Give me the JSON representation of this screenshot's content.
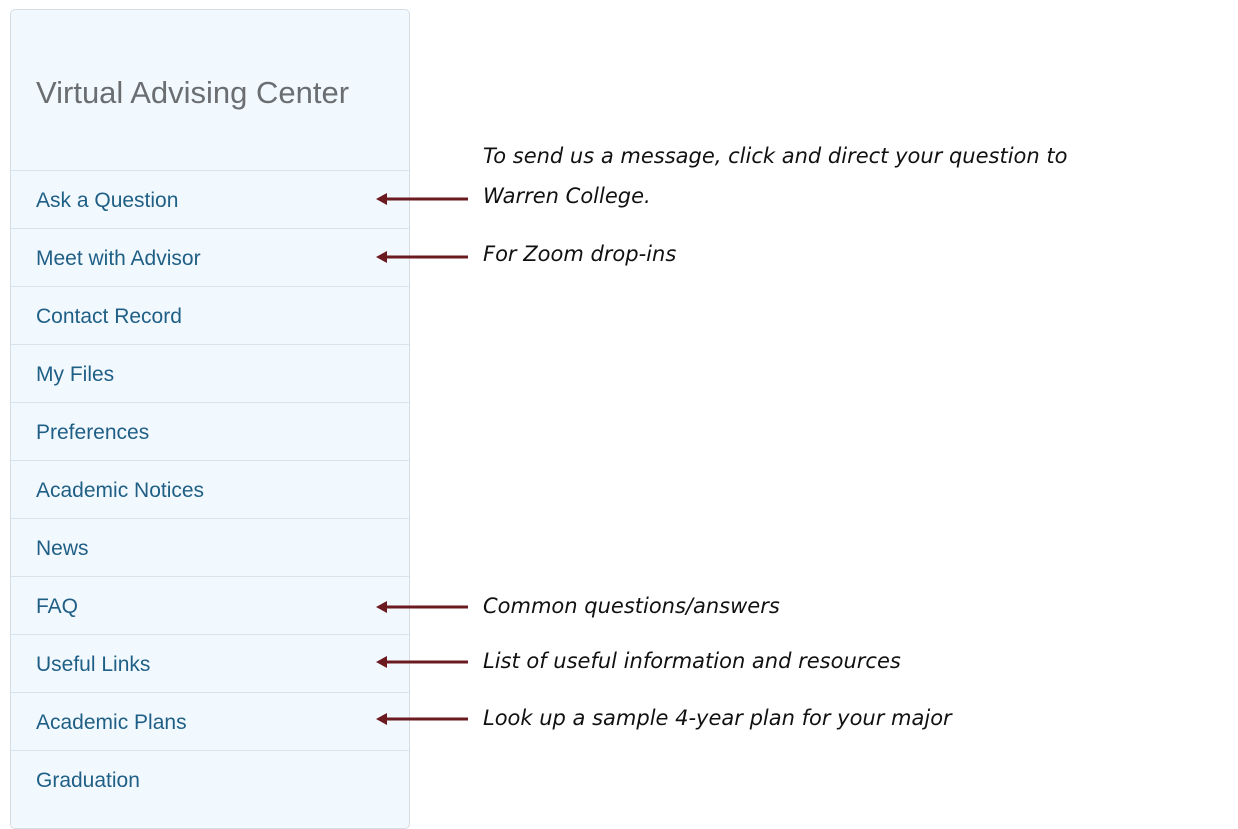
{
  "sidebar": {
    "title": "Virtual Advising Center",
    "items": [
      {
        "label": "Ask a Question"
      },
      {
        "label": "Meet with Advisor"
      },
      {
        "label": "Contact Record"
      },
      {
        "label": "My Files"
      },
      {
        "label": "Preferences"
      },
      {
        "label": "Academic Notices"
      },
      {
        "label": "News"
      },
      {
        "label": "FAQ"
      },
      {
        "label": "Useful Links"
      },
      {
        "label": "Academic Plans"
      },
      {
        "label": "Graduation"
      }
    ]
  },
  "annotations": {
    "ask_question_line1": "To send us a message,  click and direct your question to",
    "ask_question_line2": "Warren College.",
    "meet_advisor": "For Zoom drop-ins",
    "faq": "Common questions/answers",
    "useful_links": "List of useful information and resources",
    "academic_plans": "Look up a sample 4-year plan for your major"
  },
  "colors": {
    "panel_background": "#f2f9fe",
    "link_text": "#1f5f86",
    "title_text": "#6b6e71",
    "arrow": "#6b1a1f"
  }
}
